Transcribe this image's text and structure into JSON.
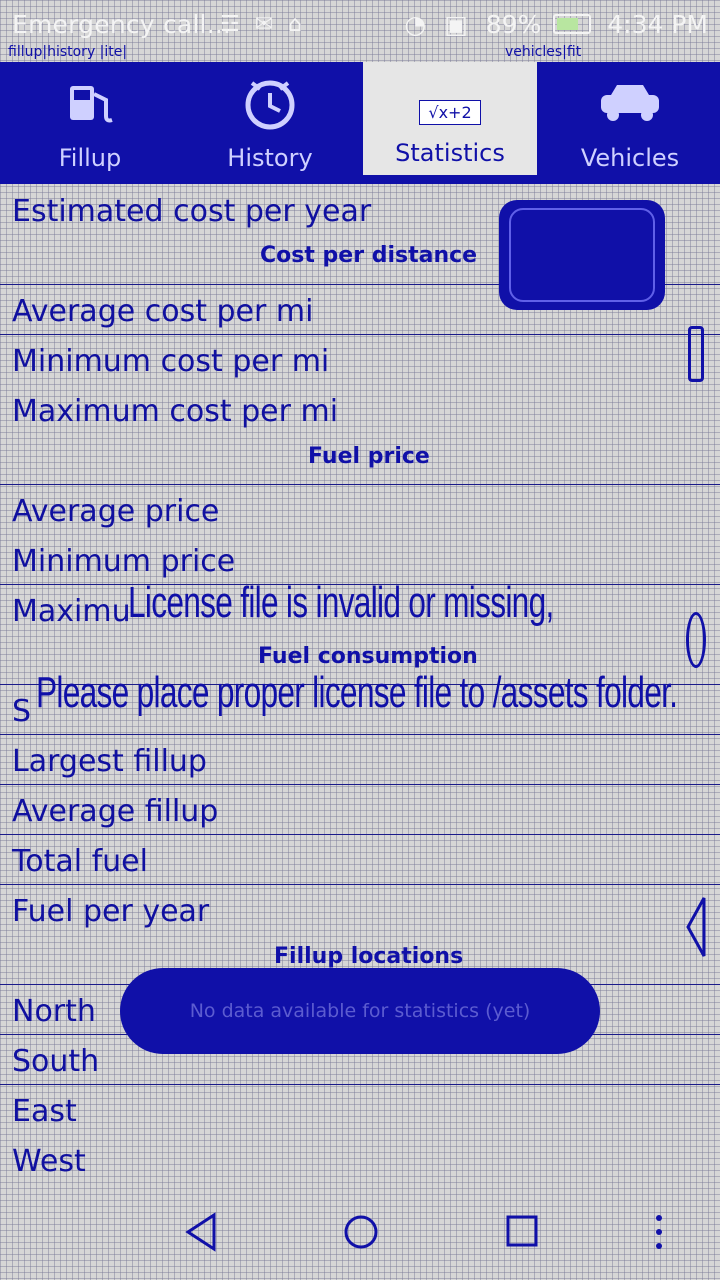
{
  "status_bar": {
    "carrier_text": "Emergency call...",
    "icons_left": [
      "signal-icon",
      "mail-icon",
      "upload-icon"
    ],
    "battery_percent": "89%",
    "time": "4:34 PM"
  },
  "app_strip": {
    "left_text": "fillup|history  |ite|",
    "right_text": "vehicles|fit"
  },
  "tabs": [
    {
      "label": "Fillup",
      "icon": "fuel-pump-icon"
    },
    {
      "label": "History",
      "icon": "clock-icon"
    },
    {
      "label": "Statistics",
      "icon": "formula-icon",
      "icon_text": "√x+2",
      "active": true
    },
    {
      "label": "Vehicles",
      "icon": "car-icon"
    }
  ],
  "rows": {
    "estimated_cost": "Estimated cost per year",
    "avg_cost": "Average cost per mi",
    "min_cost": "Minimum cost per mi",
    "max_cost": "Maximum cost per mi",
    "avg_price": "Average price",
    "min_price": "Minimum price",
    "max_price": "Maximu",
    "smallest": "S",
    "largest": "Largest fillup",
    "average_fillup": "Average fillup",
    "total_fuel": "Total fuel",
    "fuel_year": "Fuel per year",
    "north": "North",
    "south": "South",
    "east": "East",
    "west": "West"
  },
  "sections": {
    "cost_per_distance": "Cost per distance",
    "fuel_price": "Fuel price",
    "fuel_consumption": "Fuel consumption",
    "fillup_locations": "Fillup locations"
  },
  "overlay": {
    "license_line1": "License file is invalid or missing,",
    "license_line2": "Please place proper license file to /assets folder.",
    "toast": "No data available for statistics (yet)"
  },
  "nav": [
    "back-icon",
    "home-icon",
    "recents-icon",
    "menu-icon"
  ]
}
